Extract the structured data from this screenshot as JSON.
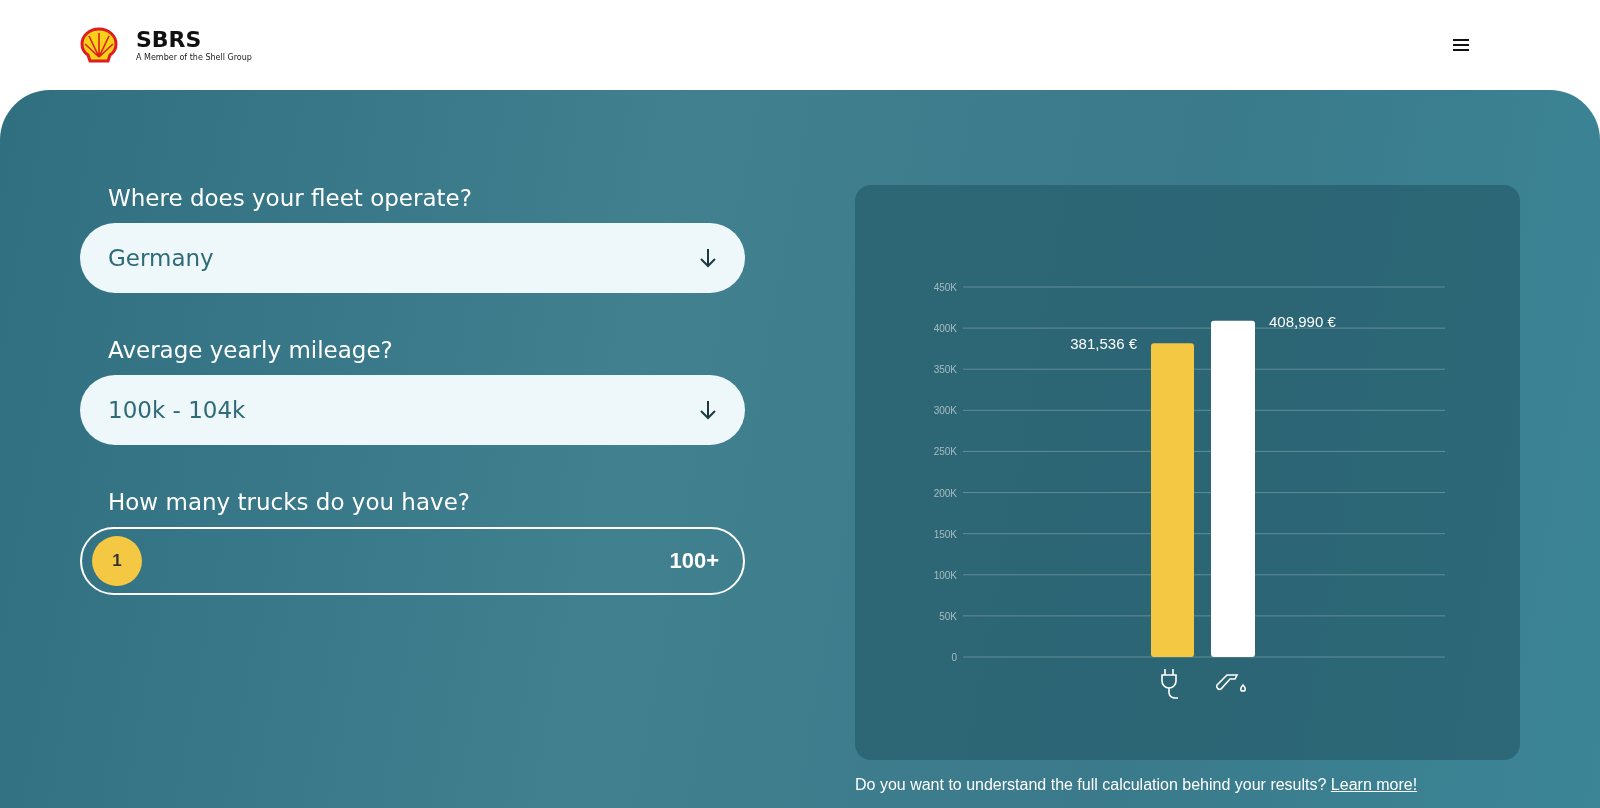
{
  "header": {
    "brand": "SBRS",
    "tagline": "A Member of the Shell Group"
  },
  "form": {
    "fields": [
      {
        "kind": "select",
        "label": "Where does your fleet operate?",
        "value": "Germany"
      },
      {
        "kind": "select",
        "label": "Average yearly mileage?",
        "value": "100k - 104k"
      },
      {
        "kind": "slider",
        "label": "How many trucks do you have?",
        "level": 0,
        "thumb": "1",
        "max_label": "100+"
      }
    ]
  },
  "results": {
    "chart_data": {
      "type": "bar",
      "grid": true,
      "series": [
        {
          "color": "#f5c843",
          "values": [
            381536
          ]
        },
        {
          "color": "#ffffff",
          "values": [
            408990
          ]
        }
      ],
      "ylim": [
        0,
        450000
      ],
      "yticks": [
        {
          "value": 0,
          "label": "0"
        },
        {
          "value": 50000,
          "label": "50K"
        },
        {
          "value": 100000,
          "label": "100K"
        },
        {
          "value": 150000,
          "label": "150K"
        },
        {
          "value": 200000,
          "label": "200K"
        },
        {
          "value": 250000,
          "label": "250K"
        },
        {
          "value": 300000,
          "label": "300K"
        },
        {
          "value": 350000,
          "label": "350K"
        },
        {
          "value": 400000,
          "label": "400K"
        },
        {
          "value": 450000,
          "label": "450K"
        }
      ],
      "value_labels": [
        "381,536 €",
        "408,990 €"
      ]
    },
    "note": "Do you want to understand the full calculation behind your results?",
    "link": "Learn more!"
  }
}
